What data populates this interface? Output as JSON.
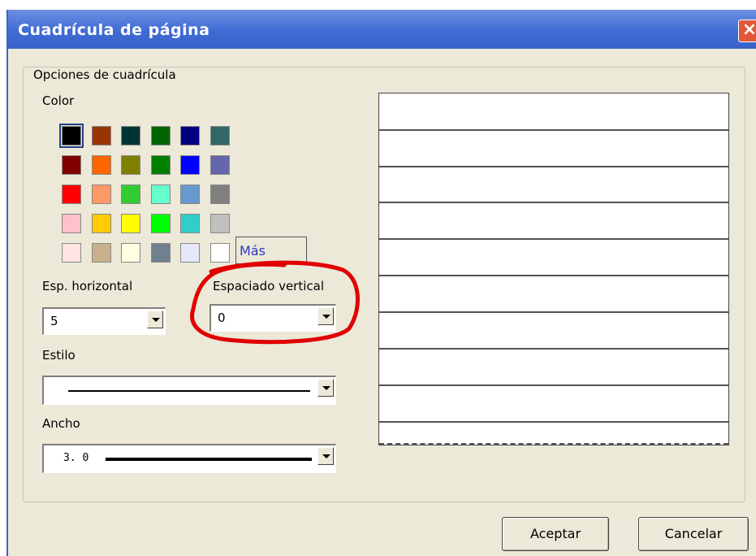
{
  "window": {
    "title": "Cuadrícula de página",
    "close_glyph": "×"
  },
  "group": {
    "legend": "Opciones de cuadrícula"
  },
  "color": {
    "label": "Color",
    "swatches": [
      [
        "#000000",
        "#993300",
        "#003333",
        "#006600",
        "#000080",
        "#336666"
      ],
      [
        "#800000",
        "#ff6600",
        "#808000",
        "#008000",
        "#0000ff",
        "#6666aa"
      ],
      [
        "#ff0000",
        "#ff9966",
        "#33cc33",
        "#66ffcc",
        "#6699cc",
        "#808080"
      ],
      [
        "#ffc0cb",
        "#ffcc00",
        "#ffff00",
        "#00ff00",
        "#33cccc",
        "#c0c0c0"
      ],
      [
        "#ffe4e1",
        "#c8b08c",
        "#ffffe0",
        "#708090",
        "#e6e6fa",
        "#ffffff"
      ]
    ],
    "more_label": "Más"
  },
  "h_spacing": {
    "label": "Esp. horizontal",
    "value": "5"
  },
  "v_spacing": {
    "label": "Espaciado vertical",
    "value": "0"
  },
  "style": {
    "label": "Estilo"
  },
  "width": {
    "label": "Ancho",
    "value": "3. 0"
  },
  "buttons": {
    "ok": "Aceptar",
    "cancel": "Cancelar"
  },
  "annotation": {
    "color": "#e00000"
  }
}
